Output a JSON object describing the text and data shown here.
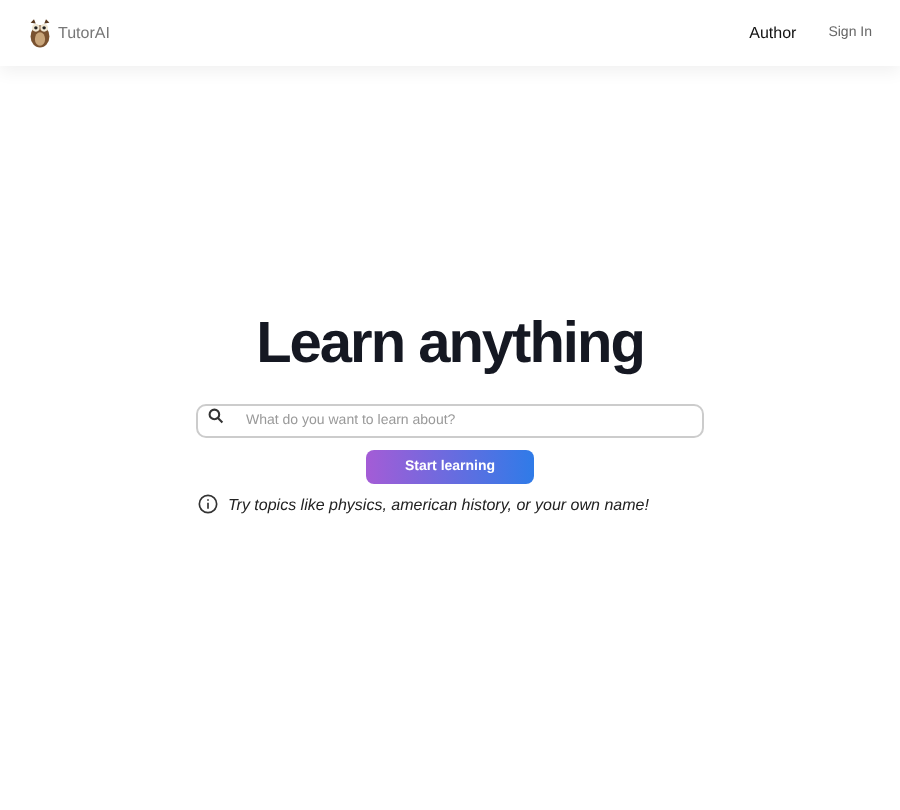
{
  "header": {
    "brand": "TutorAI",
    "nav": [
      {
        "label": "Author",
        "kind": "link"
      },
      {
        "label": "Sign In",
        "kind": "button"
      }
    ]
  },
  "hero": {
    "title": "Learn anything",
    "search": {
      "placeholder": "What do you want to learn about?"
    },
    "button": "Start learning",
    "hint": "Try topics like physics, american history, or your own name!"
  }
}
